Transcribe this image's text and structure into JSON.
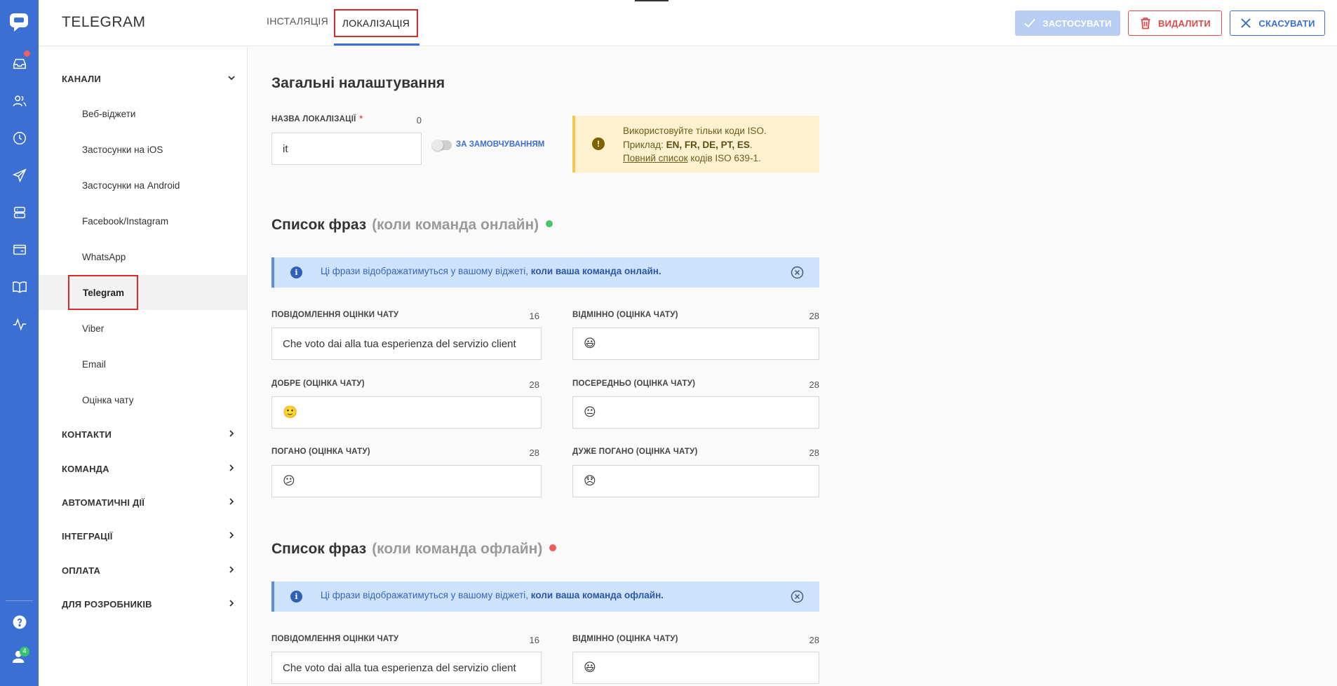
{
  "app": {
    "title": "TELEGRAM"
  },
  "tabs": [
    {
      "label": "ІНСТАЛЯЦІЯ"
    },
    {
      "label": "ЛОКАЛІЗАЦІЯ",
      "active": true
    }
  ],
  "actions": {
    "apply": "ЗАСТОСУВАТИ",
    "delete": "ВИДАЛИТИ",
    "cancel": "СКАСУВАТИ"
  },
  "rail": {
    "badge_count": "4",
    "icons": [
      "chat-logo-icon",
      "inbox-icon",
      "contacts-icon",
      "history-icon",
      "send-icon",
      "database-icon",
      "wallet-icon",
      "book-icon",
      "activity-icon",
      "help-icon",
      "user-icon"
    ]
  },
  "sidebar": {
    "channels": {
      "label": "КАНАЛИ",
      "items": [
        {
          "label": "Веб-віджети"
        },
        {
          "label": "Застосунки на iOS"
        },
        {
          "label": "Застосунки на Android"
        },
        {
          "label": "Facebook/Instagram"
        },
        {
          "label": "WhatsApp"
        },
        {
          "label": "Telegram",
          "active": true
        },
        {
          "label": "Viber"
        },
        {
          "label": "Email"
        },
        {
          "label": "Оцінка чату"
        }
      ]
    },
    "sections": [
      {
        "label": "КОНТАКТИ"
      },
      {
        "label": "КОМАНДА"
      },
      {
        "label": "АВТОМАТИЧНІ ДІЇ"
      },
      {
        "label": "ІНТЕГРАЦІЇ"
      },
      {
        "label": "ОПЛАТА"
      },
      {
        "label": "ДЛЯ РОЗРОБНИКІВ"
      }
    ]
  },
  "general": {
    "heading": "Загальні налаштування",
    "locale_label": "НАЗВА ЛОКАЛІЗАЦІЇ",
    "required_mark": "*",
    "locale_count": "0",
    "locale_value": "it",
    "default_toggle_label": "ЗА ЗАМОВЧУВАННЯМ",
    "default_toggle_on": false,
    "warning": {
      "line1": "Використовуйте тільки коди ISO.",
      "line2_prefix": "Приклад: ",
      "line2_codes": "EN, FR, DE, PT, ES",
      "line2_suffix": ".",
      "line3_link": "Повний список",
      "line3_suffix": " кодів ISO 639-1."
    }
  },
  "online": {
    "heading": "Список фраз",
    "heading_muted": "(коли команда онлайн)",
    "dot_color": "#4cc26a",
    "info_text": "Ці фрази відображатимуться у вашому віджеті, ",
    "info_bold": "коли ваша команда онлайн.",
    "fields": [
      {
        "label": "ПОВІДОМЛЕННЯ ОЦІНКИ ЧАТУ",
        "count": "16",
        "value": "Che voto dai alla tua esperienza del servizio client"
      },
      {
        "label": "ВІДМІННО (ОЦІНКА ЧАТУ)",
        "count": "28",
        "value": "😃"
      },
      {
        "label": "ДОБРЕ (ОЦІНКА ЧАТУ)",
        "count": "28",
        "value": "🙂"
      },
      {
        "label": "ПОСЕРЕДНЬО (ОЦІНКА ЧАТУ)",
        "count": "28",
        "value": "😐"
      },
      {
        "label": "ПОГАНО (ОЦІНКА ЧАТУ)",
        "count": "28",
        "value": "😕"
      },
      {
        "label": "ДУЖЕ ПОГАНО (ОЦІНКА ЧАТУ)",
        "count": "28",
        "value": "😞"
      }
    ]
  },
  "offline": {
    "heading": "Список фраз",
    "heading_muted": "(коли команда офлайн)",
    "dot_color": "#ef5b5b",
    "info_text": "Ці фрази відображатимуться у вашому віджеті, ",
    "info_bold": "коли ваша команда офлайн.",
    "fields": [
      {
        "label": "ПОВІДОМЛЕННЯ ОЦІНКИ ЧАТУ",
        "count": "16",
        "value": "Che voto dai alla tua esperienza del servizio client"
      },
      {
        "label": "ВІДМІННО (ОЦІНКА ЧАТУ)",
        "count": "28",
        "value": "😃"
      }
    ]
  },
  "colors": {
    "accent": "#3b6fd4",
    "danger": "#e04a4a",
    "highlight_box": "#d9292b"
  }
}
